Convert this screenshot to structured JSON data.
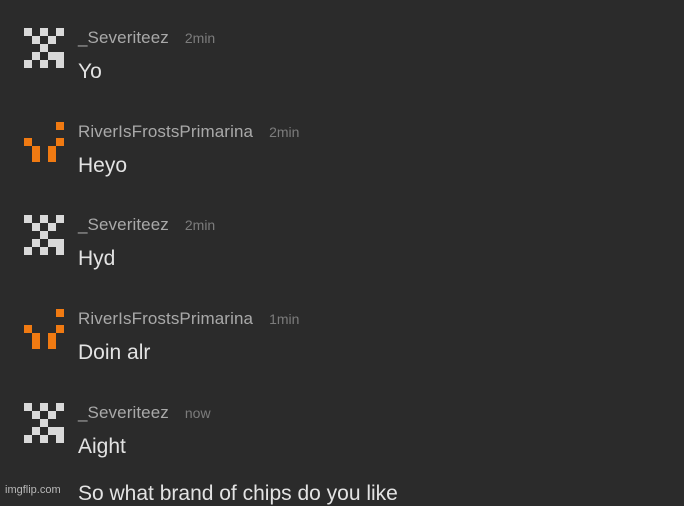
{
  "messages": [
    {
      "username": "_Severiteez",
      "time": "2min",
      "text": "Yo",
      "avatar": "checker-icon"
    },
    {
      "username": "RiverIsFrostsPrimarina",
      "time": "2min",
      "text": "Heyo",
      "avatar": "smiley-icon"
    },
    {
      "username": "_Severiteez",
      "time": "2min",
      "text": "Hyd",
      "avatar": "checker-icon"
    },
    {
      "username": "RiverIsFrostsPrimarina",
      "time": "1min",
      "text": "Doin alr",
      "avatar": "smiley-icon"
    },
    {
      "username": "_Severiteez",
      "time": "now",
      "text": "Aight",
      "avatar": "checker-icon"
    }
  ],
  "partial_message": {
    "text": "So what brand of chips do you like"
  },
  "watermark": "imgflip.com",
  "colors": {
    "background": "#2b2b2b",
    "username": "#a9a9a9",
    "timestamp": "#7c7c7c",
    "message_text": "#e3e3e3",
    "checker_avatar": "#d9d9d9",
    "smiley_avatar": "#f07a12"
  }
}
